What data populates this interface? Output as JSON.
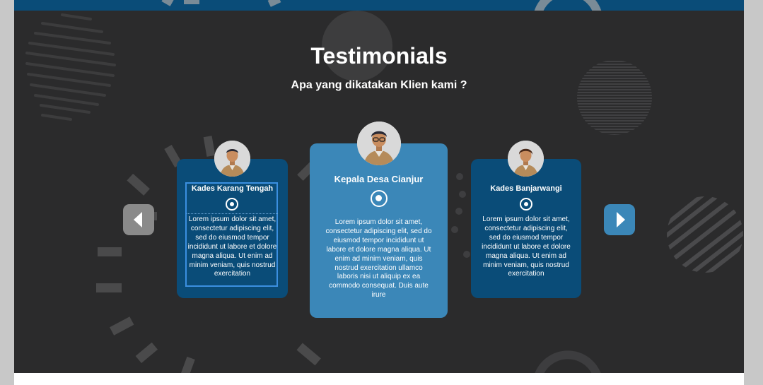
{
  "section": {
    "title": "Testimonials",
    "subtitle": "Apa yang dikatakan Klien kami ?"
  },
  "testimonials": [
    {
      "name": "Kades Karang Tengah",
      "icon": "whatsapp-icon",
      "text": "Lorem ipsum dolor sit amet, consectetur adipiscing elit, sed do eiusmod tempor incididunt ut labore et dolore magna aliqua. Ut enim ad minim veniam, quis nostrud exercitation"
    },
    {
      "name": "Kepala Desa Cianjur",
      "icon": "whatsapp-icon",
      "text": "Lorem ipsum dolor sit amet, consectetur adipiscing elit, sed do eiusmod tempor incididunt ut labore et dolore magna aliqua. Ut enim ad minim veniam, quis nostrud exercitation ullamco laboris nisi ut aliquip ex ea commodo consequat. Duis aute irure"
    },
    {
      "name": "Kades Banjarwangi",
      "icon": "whatsapp-icon",
      "text": "Lorem ipsum dolor sit amet, consectetur adipiscing elit, sed do eiusmod tempor incididunt ut labore et dolore magna aliqua. Ut enim ad minim veniam, quis nostrud exercitation"
    }
  ],
  "navigation": {
    "prev_icon": "chevron-left-icon",
    "next_icon": "chevron-right-icon"
  },
  "colors": {
    "background": "#2b2b2c",
    "card_dark": "#0a4c78",
    "card_active": "#3b87b8",
    "nav_prev": "#8a8a8a",
    "nav_next": "#3b87b8",
    "topbar": "#0a4c78"
  }
}
